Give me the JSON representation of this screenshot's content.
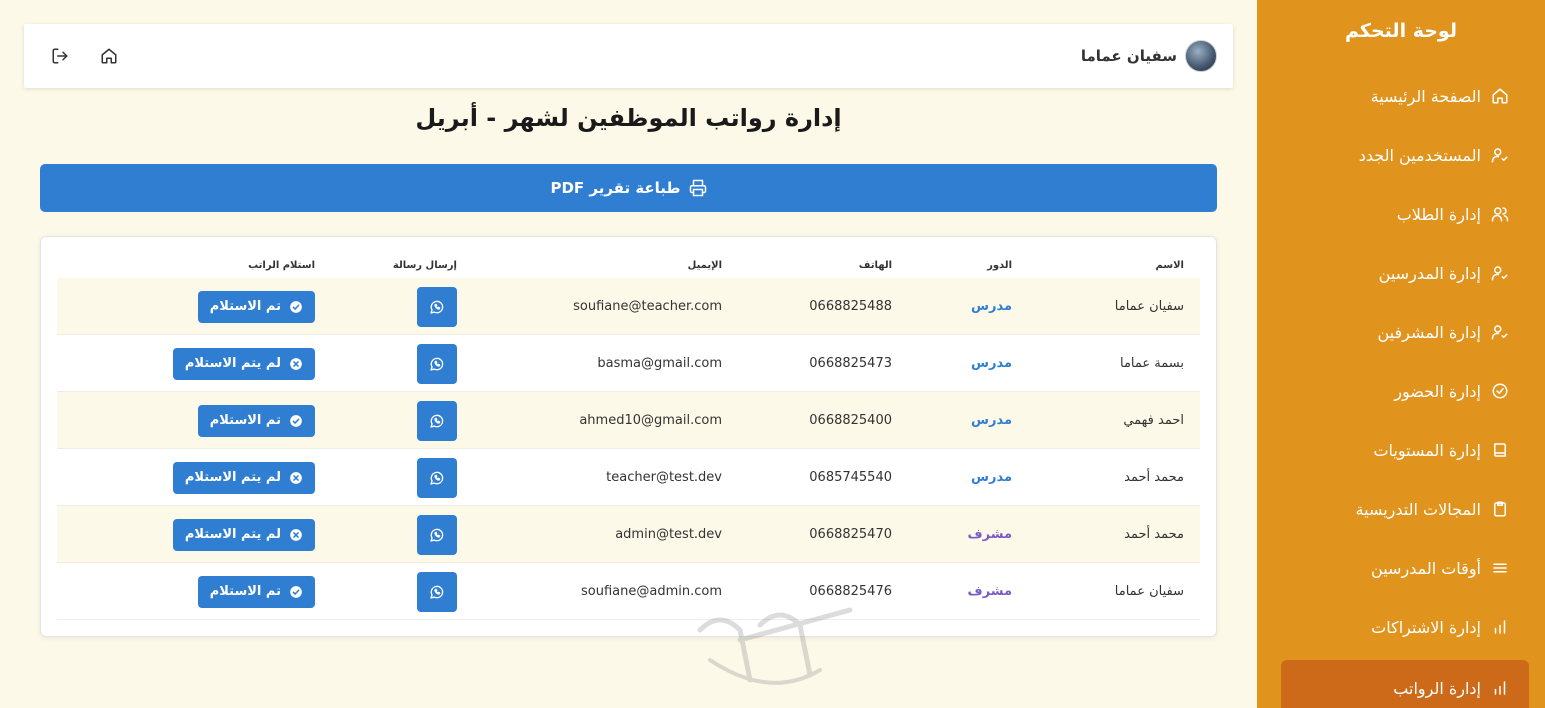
{
  "sidebar": {
    "title": "لوحة التحكم",
    "items": [
      {
        "label": "الصفحة الرئيسية",
        "icon": "home-icon"
      },
      {
        "label": "المستخدمين الجدد",
        "icon": "user-check-icon"
      },
      {
        "label": "إدارة الطلاب",
        "icon": "users-icon"
      },
      {
        "label": "إدارة المدرسين",
        "icon": "user-check-icon"
      },
      {
        "label": "إدارة المشرفين",
        "icon": "user-check-icon"
      },
      {
        "label": "إدارة الحضور",
        "icon": "check-circle-icon"
      },
      {
        "label": "إدارة المستويات",
        "icon": "book-icon"
      },
      {
        "label": "المجالات التدريسية",
        "icon": "clipboard-icon"
      },
      {
        "label": "أوقات المدرسين",
        "icon": "menu-icon"
      },
      {
        "label": "إدارة الاشتراكات",
        "icon": "bar-chart-icon"
      },
      {
        "label": "إدارة الرواتب",
        "icon": "bar-chart-icon",
        "active": true
      }
    ]
  },
  "topbar": {
    "user_name": "سفيان عماما",
    "home_icon": "home-icon",
    "logout_icon": "logout-icon"
  },
  "page": {
    "title": "إدارة رواتب الموظفين لشهر - أبريل",
    "print_label": "طباعة تقرير PDF"
  },
  "table": {
    "headers": {
      "name": "الاسم",
      "role": "الدور",
      "phone": "الهاتف",
      "email": "الإيميل",
      "send": "إرسال رسالة",
      "receive": "استلام الراتب"
    },
    "rows": [
      {
        "name": "سفيان عماما",
        "role": "مدرس",
        "phone": "0668825488",
        "email": "soufiane@teacher.com",
        "status": "تم الاستلام",
        "received": true
      },
      {
        "name": "بسمة عماما",
        "role": "مدرس",
        "phone": "0668825473",
        "email": "basma@gmail.com",
        "status": "لم يتم الاستلام",
        "received": false
      },
      {
        "name": "احمد فهمي",
        "role": "مدرس",
        "phone": "0668825400",
        "email": "ahmed10@gmail.com",
        "status": "تم الاستلام",
        "received": true
      },
      {
        "name": "محمد أحمد",
        "role": "مدرس",
        "phone": "0685745540",
        "email": "teacher@test.dev",
        "status": "لم يتم الاستلام",
        "received": false
      },
      {
        "name": "محمد أحمد",
        "role": "مشرف",
        "phone": "0668825470",
        "email": "admin@test.dev",
        "status": "لم يتم الاستلام",
        "received": false
      },
      {
        "name": "سفيان عماما",
        "role": "مشرف",
        "phone": "0668825476",
        "email": "soufiane@admin.com",
        "status": "تم الاستلام",
        "received": true
      }
    ]
  },
  "colors": {
    "sidebar": "#e0941e",
    "sidebar_active": "#cc6a19",
    "primary": "#2f7ed1",
    "teacher_role": "#2f7ed1",
    "supervisor_role": "#7b5cc4",
    "background": "#fdf9e9"
  }
}
